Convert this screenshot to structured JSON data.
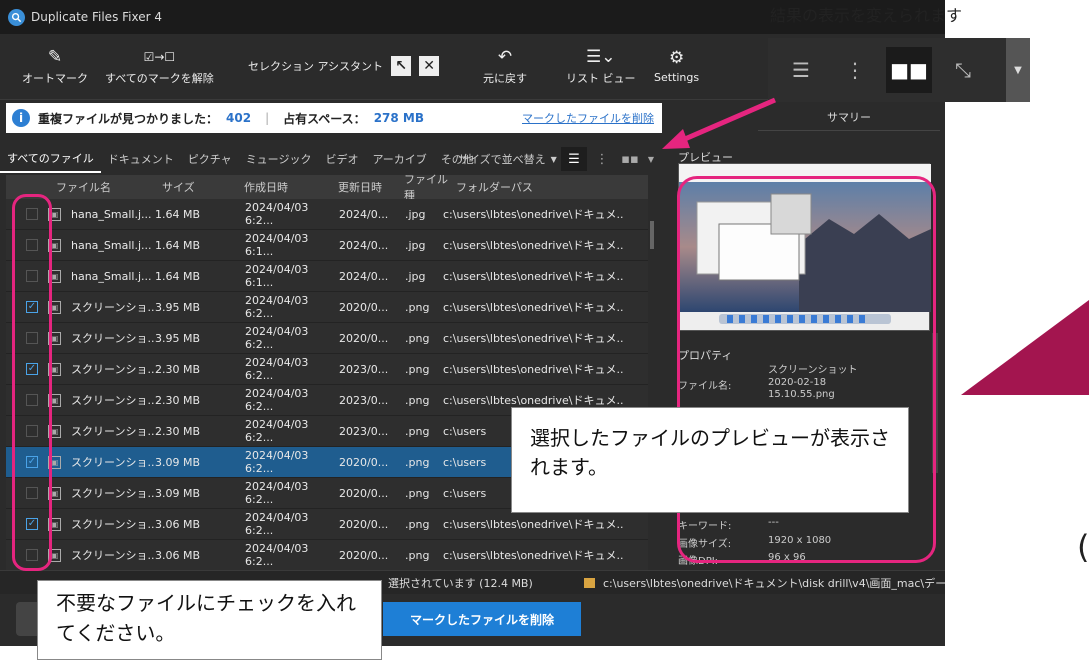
{
  "window": {
    "title": "Duplicate Files Fixer 4"
  },
  "toolbar": {
    "auto_mark": "オートマーク",
    "unmark_all": "すべてのマークを解除",
    "selection_assistant": "セレクション アシスタント",
    "undo": "元に戻す",
    "list_view": "リスト ビュー",
    "settings": "Settings"
  },
  "info": {
    "found_label": "重複ファイルが見つかりました：",
    "found_count": "402",
    "space_label": "占有スペース：",
    "space_value": "278 MB",
    "delete_link": "マークしたファイルを削除"
  },
  "tabs": [
    "すべてのファイル",
    "ドキュメント",
    "ピクチャ",
    "ミュージック",
    "ビデオ",
    "アーカイブ",
    "その他"
  ],
  "sort_label": "サイズで並べ替え",
  "columns": [
    "ファイル名",
    "サイズ",
    "作成日時",
    "更新日時",
    "ファイル種",
    "フォルダーパス"
  ],
  "rows": [
    {
      "checked": false,
      "selected": false,
      "name": "hana_Small.j...",
      "size": "1.64 MB",
      "created": "2024/04/03 6:2...",
      "modified": "2024/0...",
      "type": ".jpg",
      "path": "c:\\users\\lbtes\\onedrive\\ドキュメ..."
    },
    {
      "checked": false,
      "selected": false,
      "name": "hana_Small.j...",
      "size": "1.64 MB",
      "created": "2024/04/03 6:1...",
      "modified": "2024/0...",
      "type": ".jpg",
      "path": "c:\\users\\lbtes\\onedrive\\ドキュメ..."
    },
    {
      "checked": false,
      "selected": false,
      "name": "hana_Small.j...",
      "size": "1.64 MB",
      "created": "2024/04/03 6:1...",
      "modified": "2024/0...",
      "type": ".jpg",
      "path": "c:\\users\\lbtes\\onedrive\\ドキュメ..."
    },
    {
      "checked": true,
      "selected": false,
      "name": "スクリーンショ...",
      "size": "3.95 MB",
      "created": "2024/04/03 6:2...",
      "modified": "2020/0...",
      "type": ".png",
      "path": "c:\\users\\lbtes\\onedrive\\ドキュメ..."
    },
    {
      "checked": false,
      "selected": false,
      "name": "スクリーンショ...",
      "size": "3.95 MB",
      "created": "2024/04/03 6:2...",
      "modified": "2020/0...",
      "type": ".png",
      "path": "c:\\users\\lbtes\\onedrive\\ドキュメ..."
    },
    {
      "checked": true,
      "selected": false,
      "name": "スクリーンショ...",
      "size": "2.30 MB",
      "created": "2024/04/03 6:2...",
      "modified": "2023/0...",
      "type": ".png",
      "path": "c:\\users\\lbtes\\onedrive\\ドキュメ..."
    },
    {
      "checked": false,
      "selected": false,
      "name": "スクリーンショ...",
      "size": "2.30 MB",
      "created": "2024/04/03 6:2...",
      "modified": "2023/0...",
      "type": ".png",
      "path": "c:\\users\\lbtes\\onedrive\\ドキュメ..."
    },
    {
      "checked": false,
      "selected": false,
      "name": "スクリーンショ...",
      "size": "2.30 MB",
      "created": "2024/04/03 6:2...",
      "modified": "2023/0...",
      "type": ".png",
      "path": "c:\\users"
    },
    {
      "checked": true,
      "selected": true,
      "name": "スクリーンショ...",
      "size": "3.09 MB",
      "created": "2024/04/03 6:2...",
      "modified": "2020/0...",
      "type": ".png",
      "path": "c:\\users"
    },
    {
      "checked": false,
      "selected": false,
      "name": "スクリーンショ...",
      "size": "3.09 MB",
      "created": "2024/04/03 6:2...",
      "modified": "2020/0...",
      "type": ".png",
      "path": "c:\\users"
    },
    {
      "checked": true,
      "selected": false,
      "name": "スクリーンショ...",
      "size": "3.06 MB",
      "created": "2024/04/03 6:2...",
      "modified": "2020/0...",
      "type": ".png",
      "path": "c:\\users\\lbtes\\onedrive\\ドキュメ..."
    },
    {
      "checked": false,
      "selected": false,
      "name": "スクリーンショ...",
      "size": "3.06 MB",
      "created": "2024/04/03 6:2...",
      "modified": "2020/0...",
      "type": ".png",
      "path": "c:\\users\\lbtes\\onedrive\\ドキュメ..."
    }
  ],
  "summary": {
    "header": "サマリー",
    "preview_label": "プレビュー",
    "properties_label": "プロパティ",
    "props": [
      {
        "key": "",
        "value": "スクリーンショット\n2020-02-18\n15.10.55.png"
      },
      {
        "key": "ファイル名:",
        "value": ""
      },
      {
        "key": "キーワード:",
        "value": "---"
      },
      {
        "key": "画像サイズ:",
        "value": "1920 x 1080"
      },
      {
        "key": "画像DPI:",
        "value": "96 x 96"
      }
    ]
  },
  "status": {
    "selected_text": "選択されています (12.4 MB)",
    "path": "c:\\users\\lbtes\\onedrive\\ドキュメント\\disk drill\\v4\\画面_mac\\デー..."
  },
  "bottom": {
    "delete_button": "マークしたファイルを削除"
  },
  "annotations": {
    "top_caption": "結果の表示を変えられます",
    "preview_callout": "選択したファイルのプレビューが表示されます。",
    "check_callout": "不要なファイルにチェックを入れてください。",
    "paren": "(",
    "highlight_color": "#e5257f"
  },
  "colors": {
    "accent": "#1e7fd6",
    "link": "#2b72c9",
    "selected_row": "#1f5d8f"
  }
}
